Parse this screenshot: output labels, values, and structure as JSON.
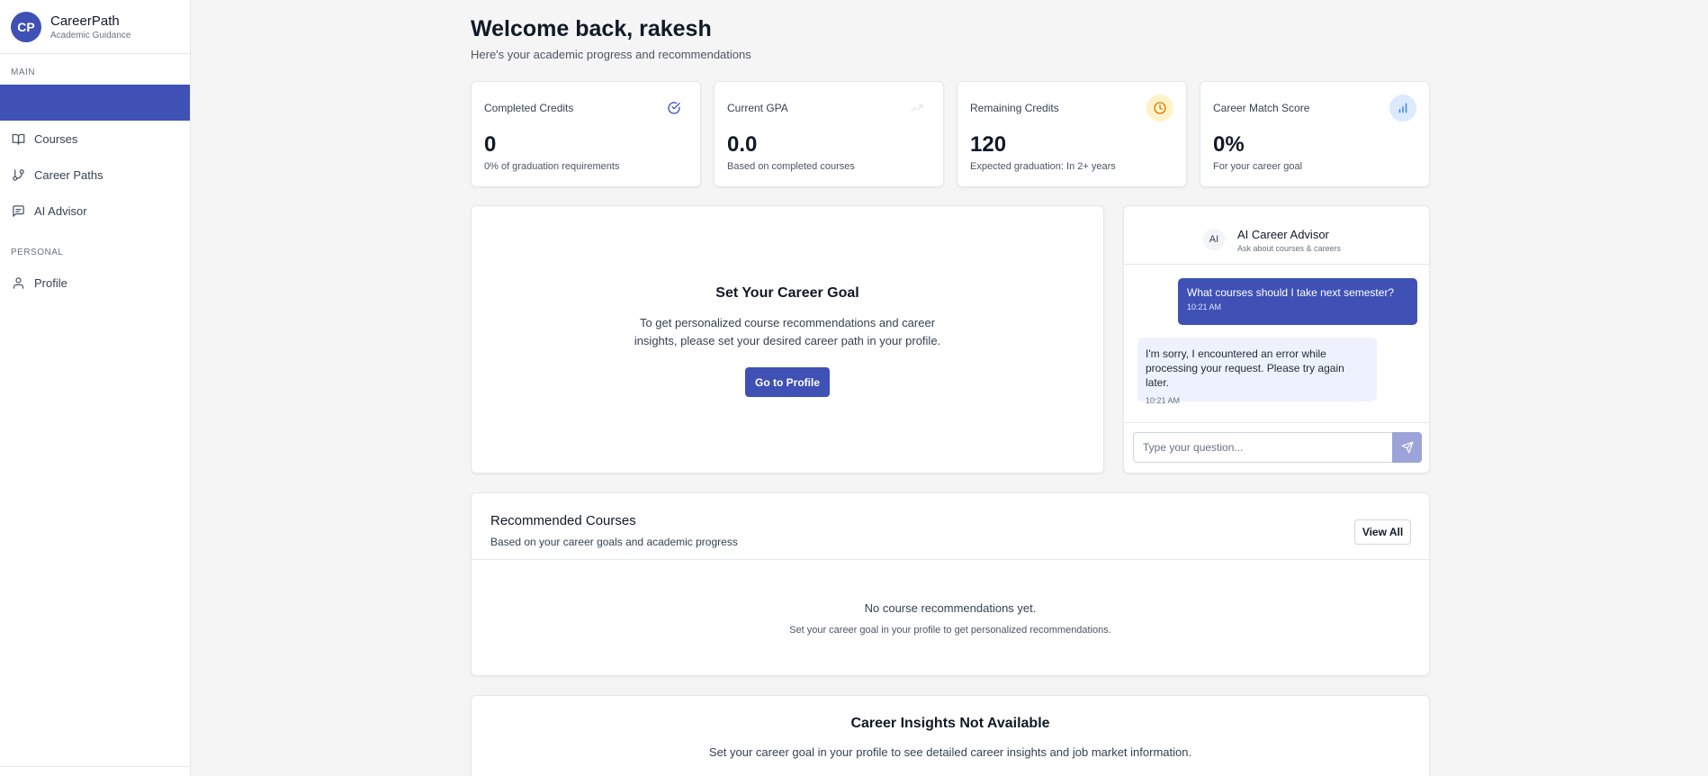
{
  "brand": {
    "initials": "CP",
    "name": "CareerPath",
    "tagline": "Academic Guidance"
  },
  "sidebar": {
    "main_section": "MAIN",
    "main_items": [
      {
        "label": "",
        "icon": "dashboard-icon",
        "active": true
      },
      {
        "label": "Courses",
        "icon": "book-open-icon"
      },
      {
        "label": "Career Paths",
        "icon": "git-branch-icon"
      },
      {
        "label": "AI Advisor",
        "icon": "message-square-icon"
      }
    ],
    "personal_section": "PERSONAL",
    "personal_items": [
      {
        "label": "Profile",
        "icon": "user-icon"
      }
    ]
  },
  "header": {
    "title": "Welcome back, rakesh",
    "subtitle": "Here's your academic progress and recommendations"
  },
  "stats": [
    {
      "label": "Completed Credits",
      "value": "0",
      "note": "0% of graduation requirements",
      "icon": "check-circle-icon"
    },
    {
      "label": "Current GPA",
      "value": "0.0",
      "note": "Based on completed courses",
      "icon": "trending-up-icon"
    },
    {
      "label": "Remaining Credits",
      "value": "120",
      "note": "Expected graduation: In 2+ years",
      "icon": "clock-icon"
    },
    {
      "label": "Career Match Score",
      "value": "0%",
      "note": "For your career goal",
      "icon": "bar-chart-icon"
    }
  ],
  "career_goal": {
    "title": "Set Your Career Goal",
    "text": "To get personalized course recommendations and career insights, please set your desired career path in your profile.",
    "button": "Go to Profile"
  },
  "advisor": {
    "avatar": "AI",
    "title": "AI Career Advisor",
    "subtitle": "Ask about courses & careers",
    "messages": [
      {
        "from": "user",
        "text": "What courses should I take next semester?",
        "time": "10:21 AM"
      },
      {
        "from": "advisor",
        "text": "I'm sorry, I encountered an error while processing your request. Please try again later.",
        "time": "10:21 AM"
      }
    ],
    "input_placeholder": "Type your question..."
  },
  "recommended": {
    "title": "Recommended Courses",
    "subtitle": "Based on your career goals and academic progress",
    "view_all": "View All",
    "empty_title": "No course recommendations yet.",
    "empty_text": "Set your career goal in your profile to get personalized recommendations."
  },
  "insights": {
    "title": "Career Insights Not Available",
    "text": "Set your career goal in your profile to see detailed career insights and job market information."
  },
  "colors": {
    "primary": "#3f51b5",
    "background": "#f5f5f5",
    "clock_badge": "#fef3c7",
    "chart_badge": "#dbeafe"
  }
}
